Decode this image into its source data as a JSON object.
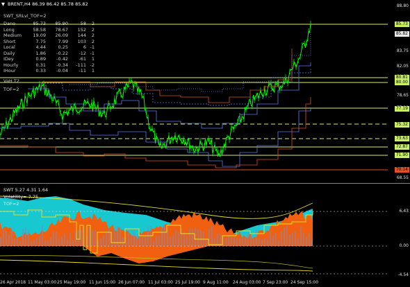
{
  "chart": {
    "symbol_header": "BRENT,H4  86.39 86.42 85.78 85.82",
    "indicator_label": "SWT_SRLvl_TOF=2",
    "vah_label": "VaH T2",
    "tof_label": "TOF=2",
    "table": [
      [
        "Dano",
        "85.73",
        "85.90",
        "58",
        "2"
      ],
      [
        "Long",
        "58.58",
        "78.67",
        "152",
        "2"
      ],
      [
        "Medium",
        "19.09",
        "26.09",
        "144",
        "2"
      ],
      [
        "Short",
        "7.75",
        "7.99",
        "103",
        "2"
      ],
      [
        "Local",
        "4.44",
        "0.25",
        "6",
        "-1"
      ],
      [
        "Daily",
        "1.86",
        "-0.22",
        "-12",
        "-1"
      ],
      [
        "IDey",
        "0.89",
        "-0.42",
        "-61",
        "1"
      ],
      [
        "Hourly",
        "0.31",
        "-0.34",
        "-111",
        "-2"
      ],
      [
        "IHour",
        "0.33",
        "-0.04",
        "-11",
        "1"
      ]
    ],
    "y_axis": [
      "88.80",
      "85.73",
      "85.82",
      "83.75",
      "82.05",
      "80.81",
      "80.00",
      "78.65",
      "77.19",
      "75.32",
      "73.63",
      "72.87",
      "71.90",
      "70.14",
      "68.55"
    ],
    "price_boxes": [
      {
        "text": "85.73",
        "color": "#c8f060"
      },
      {
        "text": "85.82",
        "color": "#e8e8e8"
      },
      {
        "text": "80.81",
        "color": "#c8f060"
      },
      {
        "text": "80.00",
        "color": "#c8f060"
      },
      {
        "text": "77.19",
        "color": "#c8f060"
      },
      {
        "text": "75.32",
        "color": "#c8f060"
      },
      {
        "text": "73.63",
        "color": "#c8f060"
      },
      {
        "text": "72.87",
        "color": "#c8f060"
      },
      {
        "text": "71.90",
        "color": "#c8f060"
      },
      {
        "text": "70.14",
        "color": "#e05020"
      }
    ]
  },
  "subchart": {
    "header": "SWT 5.27 4.31 1.64",
    "volatility": "Volatility= 7.75",
    "tof": "TOF=2",
    "y_axis": [
      "6.43",
      "0.00",
      "-4.54"
    ]
  },
  "time_axis": [
    "26 Apr 2018",
    "11 May 03:00",
    "25 May 19:00",
    "11 Jun 15:00",
    "26 Jun 07:00",
    "11 Jul 03:00",
    "25 Jul 19:00",
    "9 Aug 11:00",
    "24 Aug 03:00",
    "7 Sep 23:00",
    "24 Sep 15:00"
  ],
  "colors": {
    "price": "#00ff00",
    "level_line": "#d4f070",
    "resistance": "#e05020",
    "support_blue": "#5a7cf0",
    "cyan_area": "#18c8d0",
    "orange_area": "#f06010",
    "yellow": "#e8e020"
  }
}
